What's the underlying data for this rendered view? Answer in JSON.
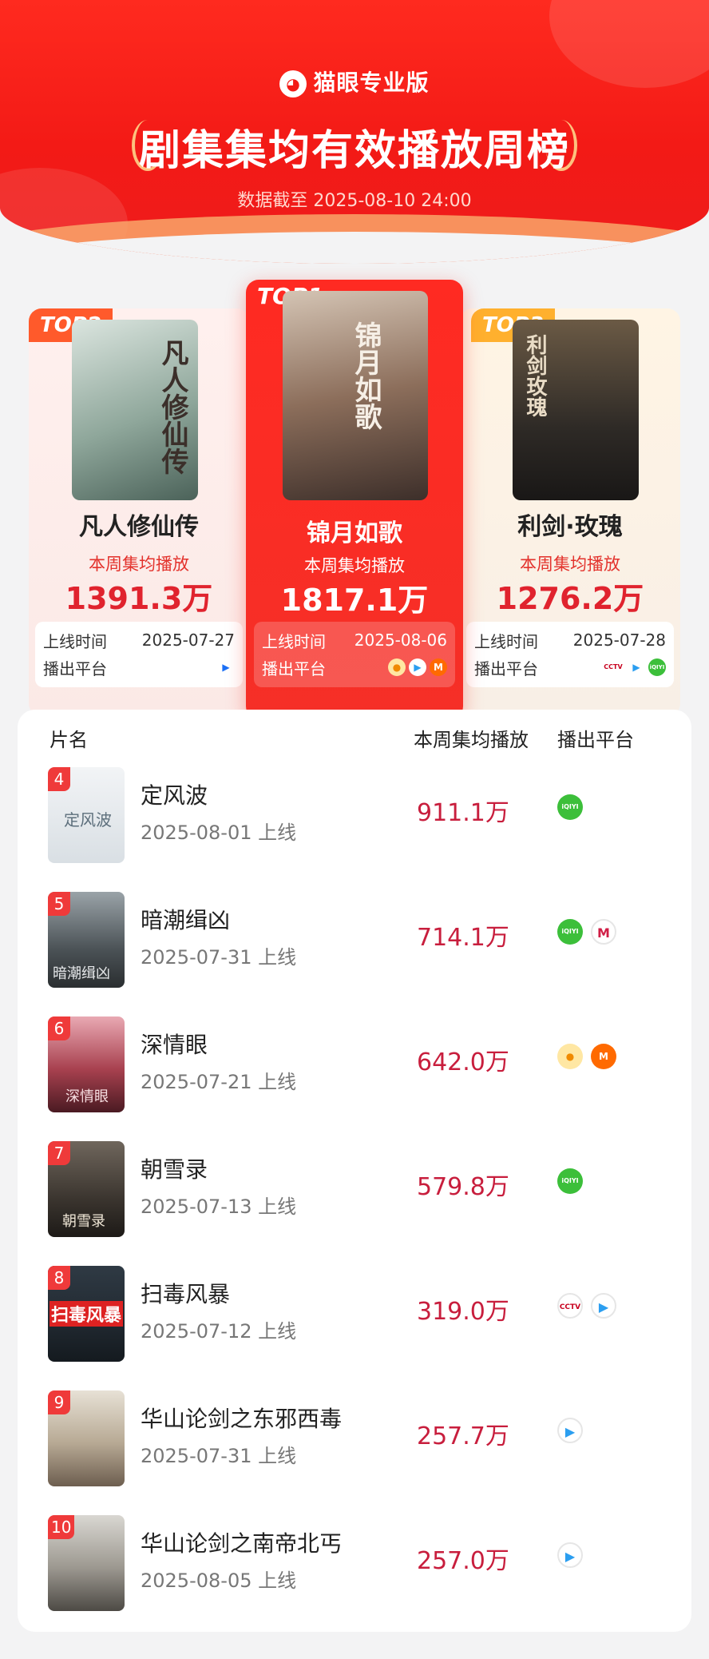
{
  "header": {
    "brand": "猫眼专业版",
    "title": "剧集集均有效播放周榜",
    "date": "数据截至 2025-08-10 24:00"
  },
  "podium": {
    "top1": {
      "tag": "TOP1",
      "name": "锦月如歌",
      "metric_label": "本周集均播放",
      "value": "1817.1万",
      "release_label": "上线时间",
      "release": "2025-08-06",
      "platform_label": "播出平台",
      "poster_text": "锦月如歌"
    },
    "top2": {
      "tag": "TOP2",
      "name": "凡人修仙传",
      "metric_label": "本周集均播放",
      "value": "1391.3万",
      "release_label": "上线时间",
      "release": "2025-07-27",
      "platform_label": "播出平台",
      "poster_text": "凡人修仙传"
    },
    "top3": {
      "tag": "TOP3",
      "name": "利剑·玫瑰",
      "metric_label": "本周集均播放",
      "value": "1276.2万",
      "release_label": "上线时间",
      "release": "2025-07-28",
      "platform_label": "播出平台",
      "poster_text": "利剑玫瑰"
    }
  },
  "list": {
    "col_name": "片名",
    "col_value": "本周集均播放",
    "col_platform": "播出平台",
    "rows": [
      {
        "rank": "4",
        "name": "定风波",
        "date": "2025-08-01 上线",
        "value": "911.1万",
        "poster_text": "定风波"
      },
      {
        "rank": "5",
        "name": "暗潮缉凶",
        "date": "2025-07-31 上线",
        "value": "714.1万",
        "poster_text": "暗潮缉凶"
      },
      {
        "rank": "6",
        "name": "深情眼",
        "date": "2025-07-21 上线",
        "value": "642.0万",
        "poster_text": "深情眼"
      },
      {
        "rank": "7",
        "name": "朝雪录",
        "date": "2025-07-13 上线",
        "value": "579.8万",
        "poster_text": "朝雪录"
      },
      {
        "rank": "8",
        "name": "扫毒风暴",
        "date": "2025-07-12 上线",
        "value": "319.0万",
        "poster_text": "扫毒风暴"
      },
      {
        "rank": "9",
        "name": "华山论剑之东邪西毒",
        "date": "2025-07-31 上线",
        "value": "257.7万",
        "poster_text": ""
      },
      {
        "rank": "10",
        "name": "华山论剑之南帝北丐",
        "date": "2025-08-05 上线",
        "value": "257.0万",
        "poster_text": ""
      }
    ]
  },
  "platform_icons": {
    "iqiyi": "iQIYI",
    "tencent": "▶",
    "mango": "M",
    "youku": "▶",
    "cctv": "CCTV",
    "migu": "M"
  },
  "colors": {
    "brand_red": "#f31a16",
    "value_red": "#c81e3d",
    "rank_red": "#ef3a3a",
    "top3_tag": "#ffb02e",
    "top2_tag": "#ff5a2b"
  }
}
